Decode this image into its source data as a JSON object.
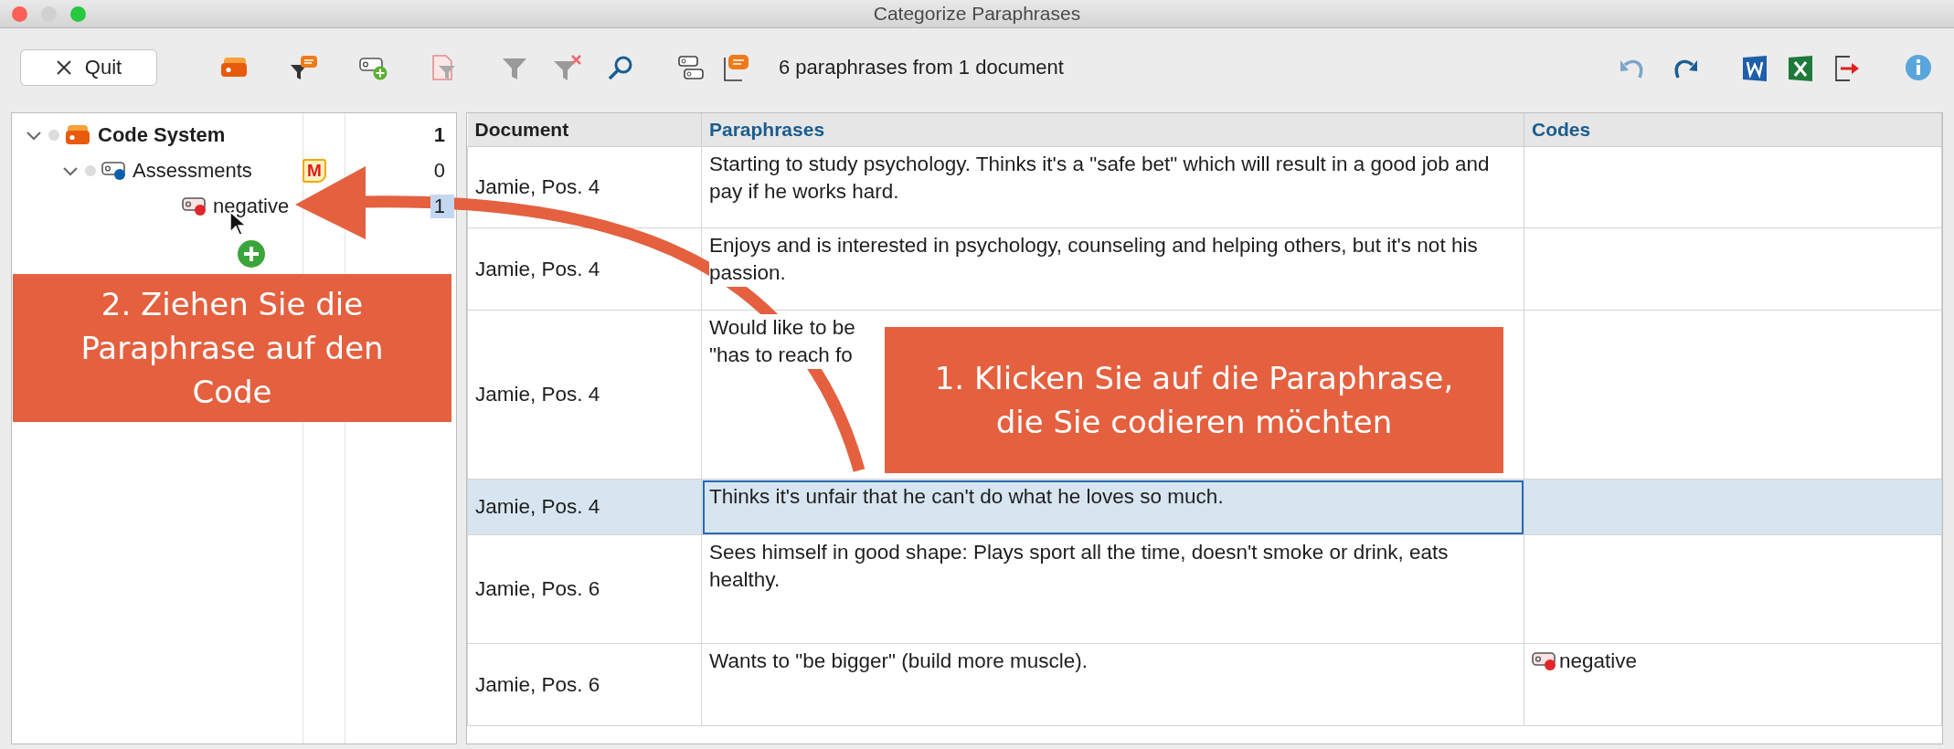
{
  "window": {
    "title": "Categorize Paraphrases"
  },
  "toolbar": {
    "quit_label": "Quit",
    "status": "6 paraphrases from 1 document"
  },
  "code_tree": [
    {
      "kind": "root",
      "label": "Code System",
      "count": "1",
      "expanded": true,
      "selected": false,
      "children": [
        {
          "kind": "code",
          "label": "Assessments",
          "color": "#0a5fa8",
          "memo": "M",
          "count": "0",
          "expanded": true,
          "selected": false,
          "children": [
            {
              "kind": "code",
              "label": "negative",
              "color": "#e0262a",
              "count": "1",
              "selected": true
            }
          ]
        }
      ]
    }
  ],
  "table": {
    "columns": [
      {
        "label": "Document",
        "highlighted": false
      },
      {
        "label": "Paraphrases",
        "highlighted": true
      },
      {
        "label": "Codes",
        "highlighted": true
      }
    ],
    "rows": [
      {
        "document": "Jamie, Pos. 4",
        "paraphrase": "Starting to study psychology. Thinks it's a \"safe bet\" which will result in a good job and pay if he works hard.",
        "codes": [],
        "selected": false
      },
      {
        "document": "Jamie, Pos. 4",
        "paraphrase": "Enjoys and is interested in psychology, counseling and helping others, but it's not his passion.",
        "codes": [],
        "selected": false
      },
      {
        "document": "Jamie, Pos. 4",
        "paraphrase": "Would like to be\n\"has to reach fo",
        "codes": [],
        "selected": false
      },
      {
        "document": "Jamie, Pos. 4",
        "paraphrase": "Thinks it's unfair that he can't do what he loves so much.",
        "codes": [],
        "selected": true
      },
      {
        "document": "Jamie, Pos. 6",
        "paraphrase": "Sees himself in good shape: Plays sport all the time, doesn't smoke or drink, eats healthy.",
        "codes": [],
        "selected": false
      },
      {
        "document": "Jamie, Pos. 6",
        "paraphrase": "Wants to \"be bigger\" (build more muscle).",
        "codes": [
          {
            "label": "negative",
            "color": "#e0262a"
          }
        ],
        "selected": false
      }
    ]
  },
  "callouts": [
    {
      "kind": "drag",
      "text": "2. Ziehen Sie die Paraphrase auf den Code"
    },
    {
      "kind": "click",
      "text": "1. Klicken Sie auf die Paraphrase, die Sie codieren möchten"
    }
  ]
}
